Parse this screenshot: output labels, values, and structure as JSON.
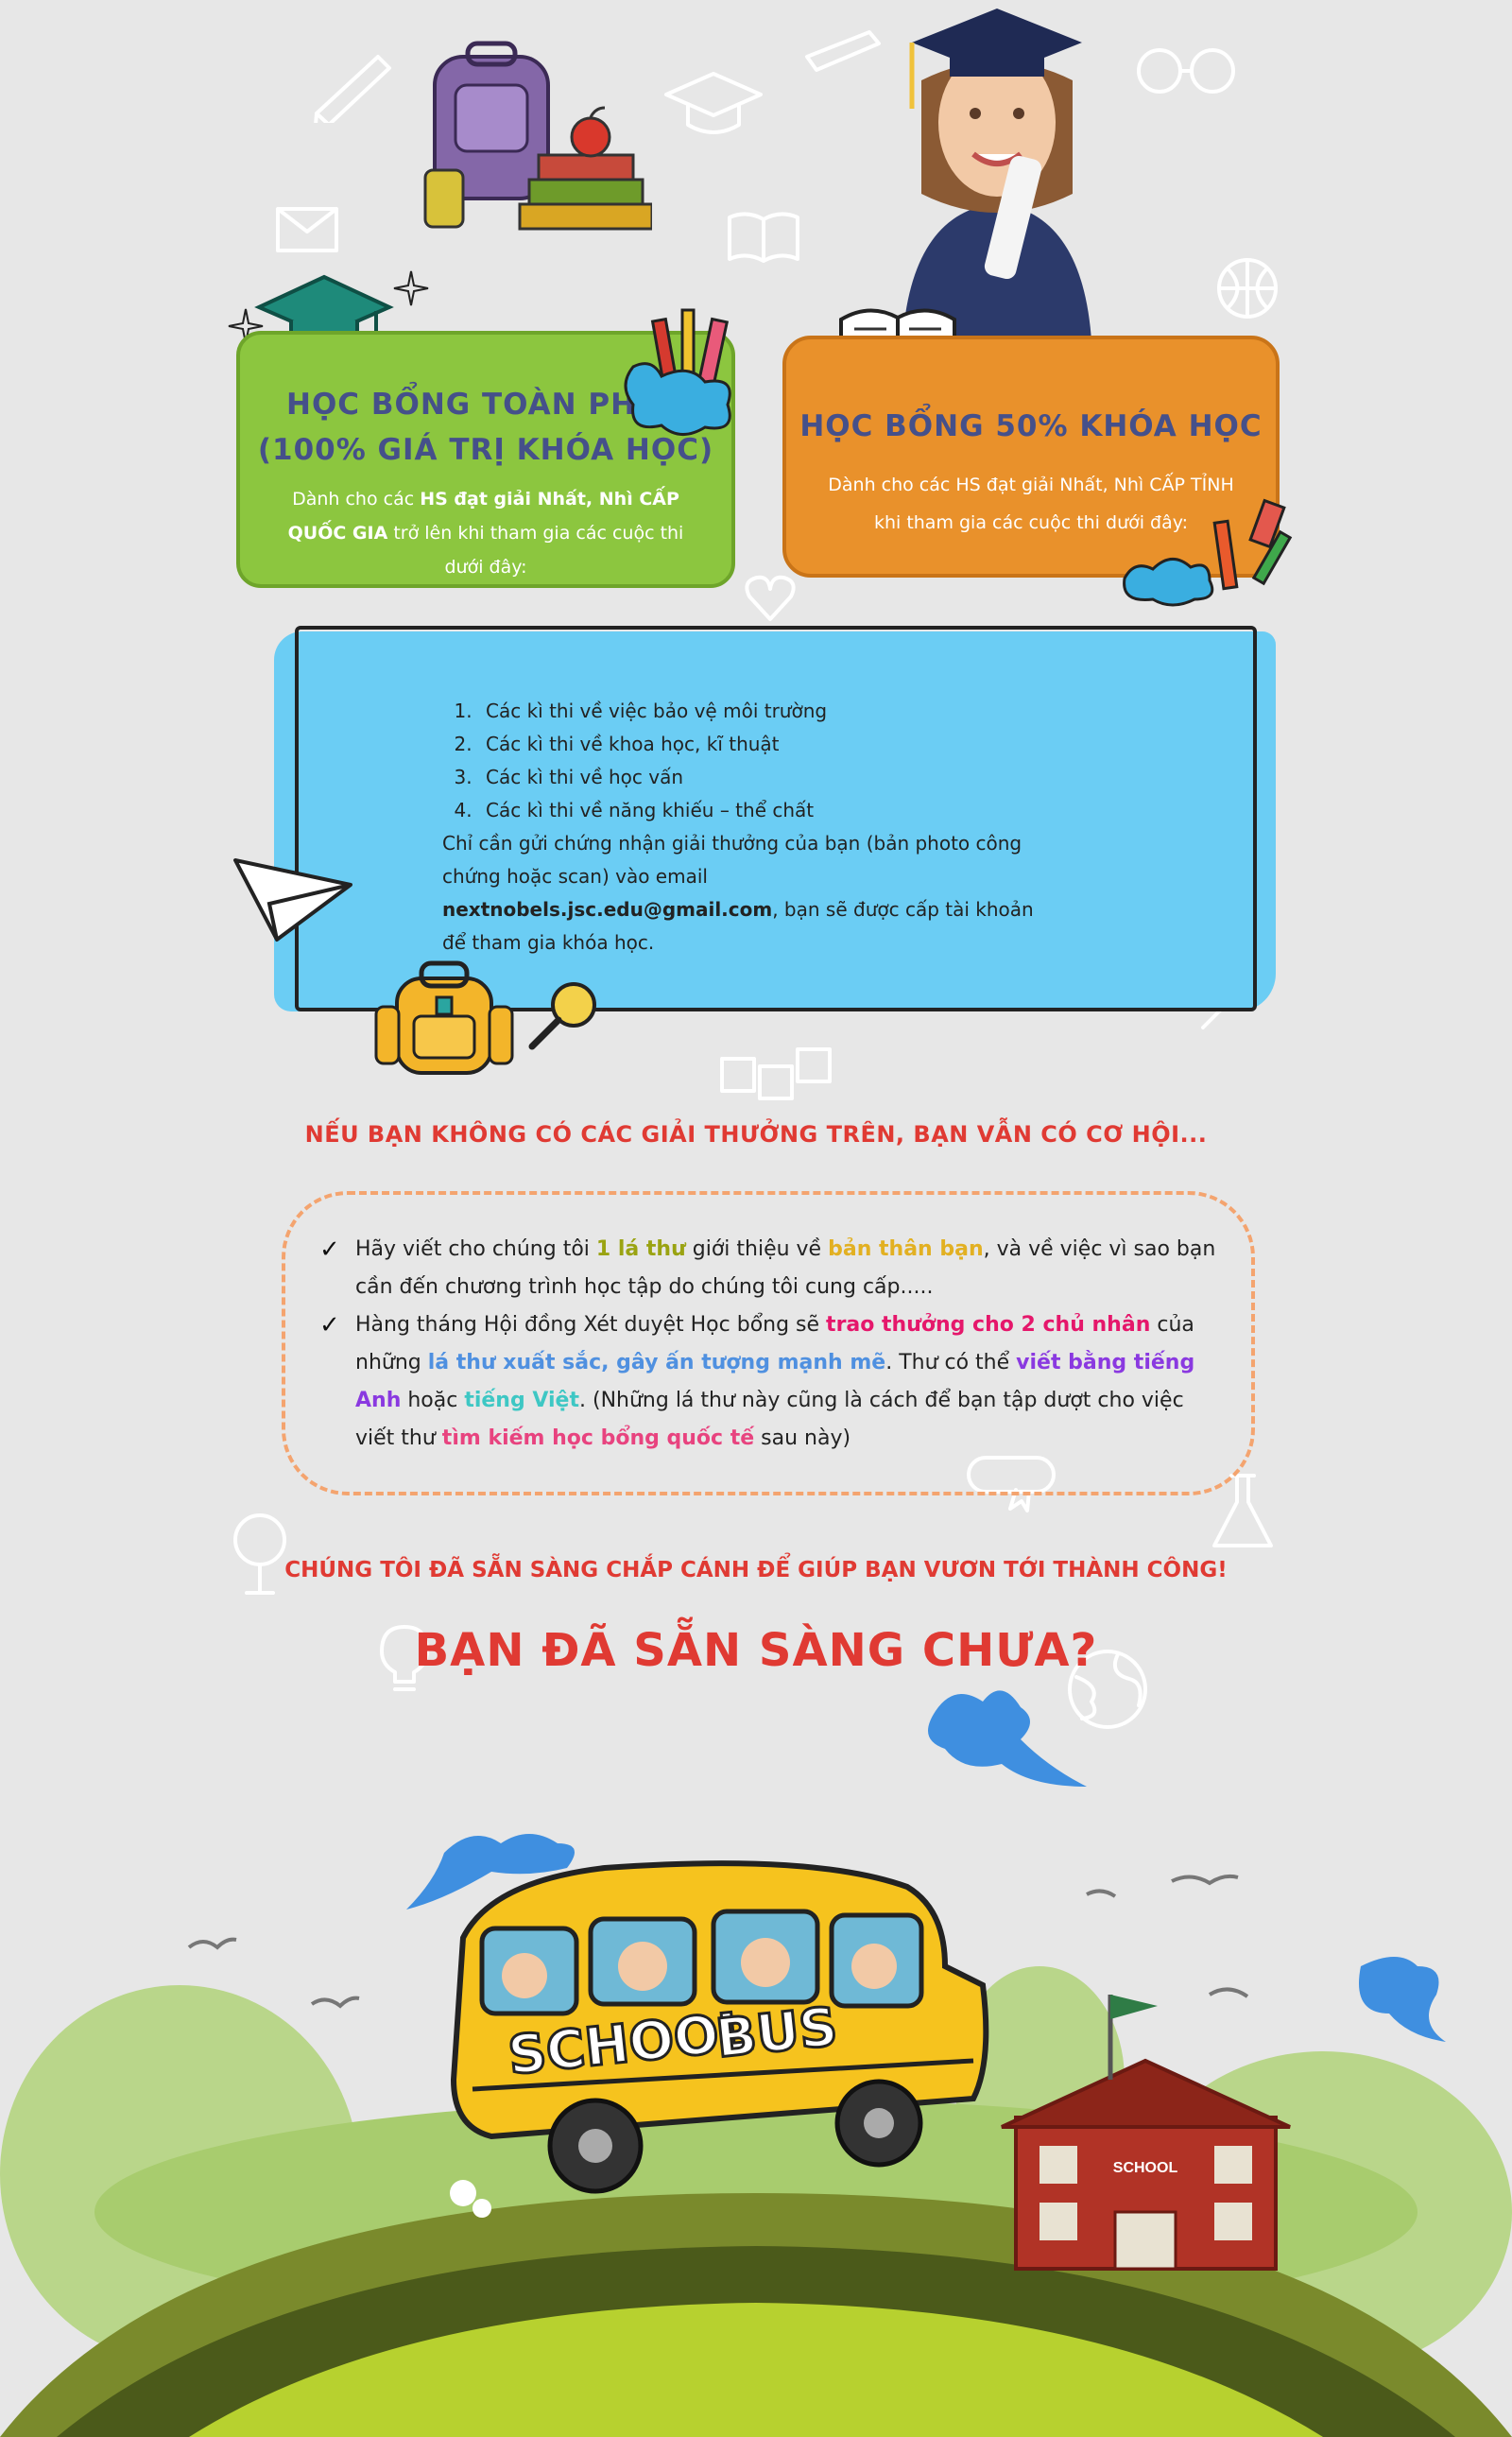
{
  "scholarship_full": {
    "title_line1": "Học bổng toàn phần",
    "title_line2": "(100% giá trị khóa học)",
    "desc_part1": "Dành cho các ",
    "desc_bold": "HS đạt giải Nhất, Nhì CẤP QUỐC GIA",
    "desc_part2": " trở lên khi tham gia các cuộc thi dưới đây:"
  },
  "scholarship_half": {
    "title": "Học bổng 50% khóa học",
    "desc_line1": "Dành cho các HS đạt giải Nhất, Nhì CẤP TỈNH",
    "desc_line2": "khi tham gia các cuộc thi dưới đây:"
  },
  "contests": {
    "items": [
      "Các kì thi về việc bảo vệ môi trường",
      "Các kì thi về khoa học, kĩ thuật",
      "Các kì thi về học vấn",
      "Các kì thi về năng khiếu – thể chất"
    ],
    "note_part1": "Chỉ cần gửi chứng nhận giải thưởng của bạn (bản photo công chứng hoặc scan) vào email ",
    "email": "nextnobels.jsc.edu@gmail.com",
    "note_part2": ", bạn sẽ được cấp tài khoản để tham gia khóa học."
  },
  "opportunity": {
    "heading": "Nếu bạn không có các giải thưởng trên, bạn vẫn có cơ hội...",
    "item1": {
      "p1": "Hãy viết cho chúng tôi ",
      "h1": "1 lá thư",
      "p2": " giới thiệu về ",
      "h2": "bản thân bạn",
      "p3": ", và về việc vì sao bạn cần đến chương trình học tập do chúng tôi cung cấp....."
    },
    "item2": {
      "p1": "Hàng tháng Hội đồng Xét duyệt Học bổng sẽ ",
      "h1": "trao thưởng cho 2 chủ nhân",
      "p2": " của những ",
      "h2": "lá thư xuất sắc, gây ấn tượng mạnh mẽ",
      "p3": ". Thư có thể ",
      "h3": "viết bằng tiếng Anh",
      "p4": " hoặc ",
      "h4": "tiếng Việt",
      "p5": ". (Những lá thư này cũng là cách để bạn tập dượt cho việc viết thư ",
      "h5": "tìm kiếm học bổng quốc tế",
      "p6": " sau này)"
    }
  },
  "closing": {
    "tagline": "Chúng tôi đã sẵn sàng chắp cánh để giúp bạn vươn tới thành công!",
    "question": "Bạn đã sẵn sàng chưa?"
  },
  "illustration": {
    "bus_word1": "SCHOOL",
    "bus_word2": "BUS",
    "school_sign": "SCHOOL"
  },
  "colors": {
    "background": "#e7e7e7",
    "green_card": "#8cc63f",
    "orange_card": "#e9912b",
    "blue_box": "#6bcdf4",
    "heading_red": "#e03a33",
    "card_title": "#45508a"
  }
}
